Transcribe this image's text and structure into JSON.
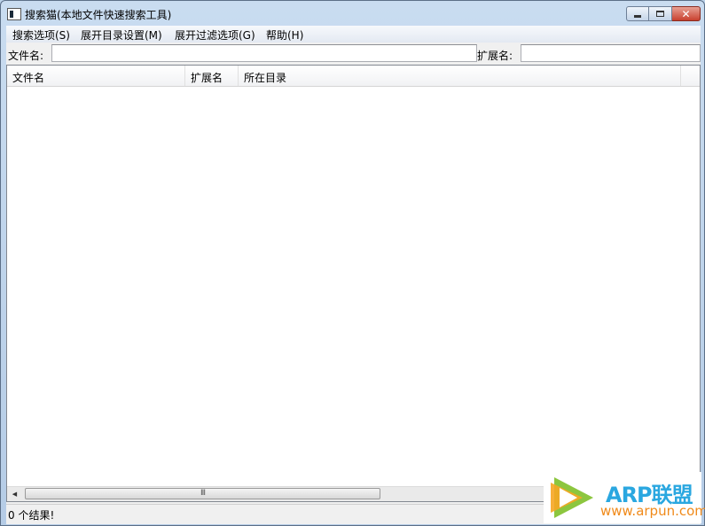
{
  "window": {
    "title": "搜索猫(本地文件快速搜索工具)",
    "close_glyph": "✕"
  },
  "menu": {
    "items": [
      "搜索选项(S)",
      "展开目录设置(M)",
      "展开过滤选项(G)",
      "帮助(H)"
    ]
  },
  "search": {
    "filename_label": "文件名:",
    "filename_value": "",
    "ext_label": "扩展名:",
    "ext_value": ""
  },
  "results": {
    "columns": [
      "文件名",
      "扩展名",
      "所在目录"
    ],
    "rows": []
  },
  "scrollbar": {
    "left_arrow": "◀",
    "grip": "III"
  },
  "status": {
    "text": "0 个结果!"
  },
  "watermark": {
    "brand": "ARP联盟",
    "url": "www.arpun.com"
  },
  "colors": {
    "close_button": "#c8412f",
    "brand_blue": "#2aa7e0",
    "url_orange": "#f08a1a",
    "logo_green": "#8cc63f"
  }
}
